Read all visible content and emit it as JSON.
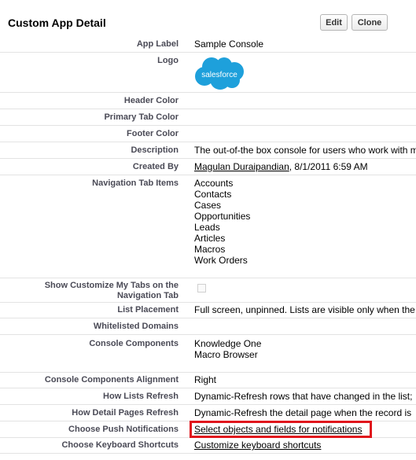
{
  "header": {
    "title": "Custom App Detail",
    "edit_label": "Edit",
    "clone_label": "Clone"
  },
  "fields": {
    "app_label": {
      "label": "App Label",
      "value": "Sample Console"
    },
    "logo": {
      "label": "Logo",
      "logo_text": "salesforce",
      "logo_color": "#1ea0db"
    },
    "header_color": {
      "label": "Header Color"
    },
    "primary_tab_color": {
      "label": "Primary Tab Color"
    },
    "footer_color": {
      "label": "Footer Color"
    },
    "description": {
      "label": "Description",
      "value": "The out-of-the box console for users who work with m"
    },
    "created_by": {
      "label": "Created By",
      "user": "Magulan Duraipandian",
      "date": ", 8/1/2011 6:59 AM"
    },
    "navigation_tab_items": {
      "label": "Navigation Tab Items",
      "items": [
        "Accounts",
        "Contacts",
        "Cases",
        "Opportunities",
        "Leads",
        "Articles",
        "Macros",
        "Work Orders"
      ]
    },
    "show_customize_tabs": {
      "label_line1": "Show Customize My Tabs on the",
      "label_line2": "Navigation Tab"
    },
    "list_placement": {
      "label": "List Placement",
      "value": "Full screen, unpinned. Lists are visible only when the"
    },
    "whitelisted_domains": {
      "label": "Whitelisted Domains"
    },
    "console_components": {
      "label": "Console Components",
      "items": [
        "Knowledge One",
        "Macro Browser"
      ]
    },
    "console_components_alignment": {
      "label": "Console Components Alignment",
      "value": "Right"
    },
    "how_lists_refresh": {
      "label": "How Lists Refresh",
      "value": "Dynamic-Refresh rows that have changed in the list;"
    },
    "how_detail_pages_refresh": {
      "label": "How Detail Pages Refresh",
      "value": "Dynamic-Refresh the detail page when the record is"
    },
    "push_notifications": {
      "label": "Choose Push Notifications",
      "link": "Select objects and fields for notifications"
    },
    "keyboard_shortcuts": {
      "label": "Choose Keyboard Shortcuts",
      "link": "Customize keyboard shortcuts"
    }
  },
  "highlight_color": "#e0151c"
}
